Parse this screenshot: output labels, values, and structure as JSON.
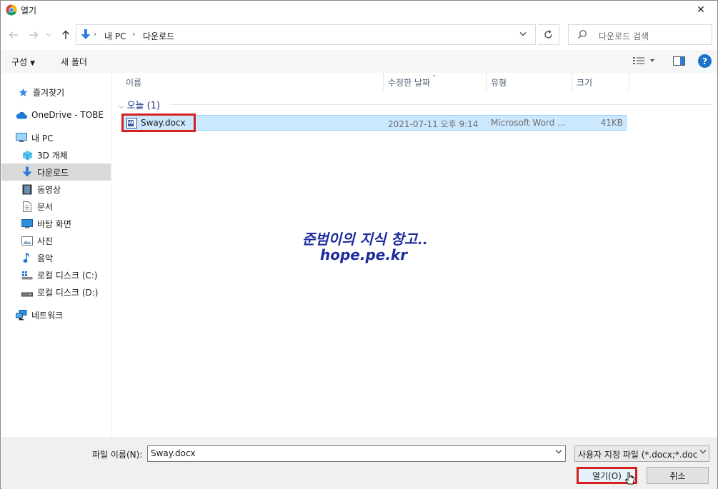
{
  "window": {
    "title": "열기",
    "close": "✕"
  },
  "nav": {
    "back_icon": "arrow-left-icon",
    "forward_icon": "arrow-right-icon",
    "up_icon": "arrow-up-icon",
    "breadcrumb": [
      "내 PC",
      "다운로드"
    ],
    "search_placeholder": "다운로드 검색"
  },
  "command": {
    "organize": "구성",
    "new_folder": "새 폴더",
    "help": "?"
  },
  "sidebar": {
    "items": [
      {
        "label": "즐겨찾기",
        "icon": "star-icon"
      },
      {
        "label": "OneDrive - TOBE",
        "icon": "cloud-icon"
      },
      {
        "label": "내 PC",
        "icon": "computer-icon"
      },
      {
        "label": "3D 개체",
        "icon": "cube-icon"
      },
      {
        "label": "다운로드",
        "icon": "download-icon"
      },
      {
        "label": "동영상",
        "icon": "video-icon"
      },
      {
        "label": "문서",
        "icon": "document-icon"
      },
      {
        "label": "바탕 화면",
        "icon": "desktop-icon"
      },
      {
        "label": "사진",
        "icon": "picture-icon"
      },
      {
        "label": "음악",
        "icon": "music-icon"
      },
      {
        "label": "로컬 디스크 (C:)",
        "icon": "drive-icon"
      },
      {
        "label": "로컬 디스크 (D:)",
        "icon": "drive-icon"
      },
      {
        "label": "네트워크",
        "icon": "network-icon"
      }
    ]
  },
  "columns": {
    "name": "이름",
    "modified": "수정한 날짜",
    "type": "유형",
    "size": "크기"
  },
  "group": {
    "label": "오늘 (1)"
  },
  "files": [
    {
      "name": "Sway.docx",
      "modified": "2021-07-11 오후 9:14",
      "type": "Microsoft Word ...",
      "size": "41KB"
    }
  ],
  "watermark": {
    "line1": "준범이의 지식 창고..",
    "line2": "hope.pe.kr"
  },
  "footer": {
    "filename_label": "파일 이름(N):",
    "filename_value": "Sway.docx",
    "filter_value": "사용자 지정 파일 (*.docx;*.doc",
    "open_label": "열기(O)",
    "cancel_label": "취소"
  },
  "colors": {
    "selection": "#cce8ff",
    "highlight_box": "#d62020",
    "accent": "#1a73c8"
  }
}
